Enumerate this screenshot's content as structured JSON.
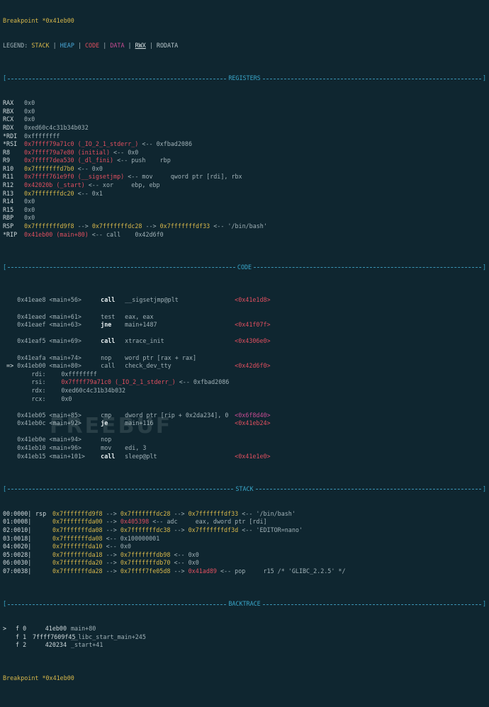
{
  "breakpoint_top": "Breakpoint *0x41eb00",
  "legend": {
    "prefix": "LEGEND: ",
    "items": [
      {
        "label": "STACK",
        "color": "#d7b74a"
      },
      {
        "label": "HEAP",
        "color": "#4aa8d8"
      },
      {
        "label": "CODE",
        "color": "#e04f5f"
      },
      {
        "label": "DATA",
        "color": "#c84c93"
      },
      {
        "label": "RWX",
        "color": "#d9e2e4"
      },
      {
        "label": "RODATA",
        "color": "#b9c7cc"
      }
    ],
    "sep": " | "
  },
  "sections": {
    "registers": "REGISTERS",
    "code": "CODE",
    "stack": "STACK",
    "backtrace": "BACKTRACE"
  },
  "registers": [
    {
      "name": "RAX",
      "parts": [
        {
          "t": "0x0",
          "c": "dim"
        }
      ]
    },
    {
      "name": "RBX",
      "parts": [
        {
          "t": "0x0",
          "c": "dim"
        }
      ]
    },
    {
      "name": "RCX",
      "parts": [
        {
          "t": "0x0",
          "c": "dim"
        }
      ]
    },
    {
      "name": "RDX",
      "parts": [
        {
          "t": "0xed60c4c31b34b032",
          "c": "dim"
        }
      ]
    },
    {
      "name": "*RDI",
      "parts": [
        {
          "t": "0xffffffff",
          "c": "dim"
        }
      ]
    },
    {
      "name": "*RSI",
      "parts": [
        {
          "t": "0x7ffff79a71c0 (_IO_2_1_stderr_)",
          "c": "red"
        },
        {
          "t": " <-- 0xfbad2086",
          "c": "dim"
        }
      ]
    },
    {
      "name": "R8",
      "parts": [
        {
          "t": "0x7ffff79a7e80 (initial)",
          "c": "red"
        },
        {
          "t": " <-- 0x0",
          "c": "dim"
        }
      ]
    },
    {
      "name": "R9",
      "parts": [
        {
          "t": "0x7ffff7dea530 (_dl_fini)",
          "c": "red"
        },
        {
          "t": " <-- push    rbp",
          "c": "dim"
        }
      ]
    },
    {
      "name": "R10",
      "parts": [
        {
          "t": "0x7fffffffd7b0",
          "c": "yellow"
        },
        {
          "t": " <-- 0x0",
          "c": "dim"
        }
      ]
    },
    {
      "name": "R11",
      "parts": [
        {
          "t": "0x7ffff761e9f0 (__sigsetjmp)",
          "c": "red"
        },
        {
          "t": " <-- mov     qword ptr [rdi], rbx",
          "c": "dim"
        }
      ]
    },
    {
      "name": "R12",
      "parts": [
        {
          "t": "0x42020b (_start)",
          "c": "red"
        },
        {
          "t": " <-- xor     ebp, ebp",
          "c": "dim"
        }
      ]
    },
    {
      "name": "R13",
      "parts": [
        {
          "t": "0x7fffffffdc20",
          "c": "yellow"
        },
        {
          "t": " <-- 0x1",
          "c": "dim"
        }
      ]
    },
    {
      "name": "R14",
      "parts": [
        {
          "t": "0x0",
          "c": "dim"
        }
      ]
    },
    {
      "name": "R15",
      "parts": [
        {
          "t": "0x0",
          "c": "dim"
        }
      ]
    },
    {
      "name": "RBP",
      "parts": [
        {
          "t": "0x0",
          "c": "dim"
        }
      ]
    },
    {
      "name": "RSP",
      "parts": [
        {
          "t": "0x7fffffffd9f8",
          "c": "yellow"
        },
        {
          "t": " --> ",
          "c": "dim"
        },
        {
          "t": "0x7fffffffdc28",
          "c": "yellow"
        },
        {
          "t": " --> ",
          "c": "dim"
        },
        {
          "t": "0x7fffffffdf33",
          "c": "yellow"
        },
        {
          "t": " <-- '/bin/bash'",
          "c": "dim"
        }
      ]
    },
    {
      "name": "*RIP",
      "parts": [
        {
          "t": "0x41eb00 (main+80)",
          "c": "red"
        },
        {
          "t": " <-- call    0x42d6f0",
          "c": "dim"
        }
      ]
    }
  ],
  "code": [
    {
      "gap": true
    },
    {
      "addr": "0x41eae8 <main+56>",
      "ins": "call",
      "bold": true,
      "op": "__sigsetjmp@plt",
      "target": "<0x41e1d8>"
    },
    {
      "gap": true
    },
    {
      "addr": "0x41eaed <main+61>",
      "ins": "test",
      "op": "eax, eax"
    },
    {
      "addr": "0x41eaef <main+63>",
      "ins": "jne",
      "bold": true,
      "op": "main+1487",
      "target": "<0x41f07f>"
    },
    {
      "gap": true
    },
    {
      "addr": "0x41eaf5 <main+69>",
      "ins": "call",
      "bold": true,
      "op": "xtrace_init",
      "target": "<0x4306e0>"
    },
    {
      "gap": true
    },
    {
      "addr": "0x41eafa <main+74>",
      "ins": "nop",
      "op": "word ptr [rax + rax]"
    },
    {
      "addr": "0x41eb00 <main+80>",
      "current": true,
      "ins": "call",
      "op": "check_dev_tty",
      "target": "<0x42d6f0>"
    },
    {
      "argname": "rdi:",
      "argparts": [
        {
          "t": "0xffffffff",
          "c": "dim"
        }
      ]
    },
    {
      "argname": "rsi:",
      "argparts": [
        {
          "t": "0x7ffff79a71c0 (_IO_2_1_stderr_)",
          "c": "red"
        },
        {
          "t": " <-- 0xfbad2086",
          "c": "dim"
        }
      ]
    },
    {
      "argname": "rdx:",
      "argparts": [
        {
          "t": "0xed60c4c31b34b032",
          "c": "dim"
        }
      ]
    },
    {
      "argname": "rcx:",
      "argparts": [
        {
          "t": "0x0",
          "c": "dim"
        }
      ]
    },
    {
      "gap": true
    },
    {
      "addr": "0x41eb05 <main+85>",
      "ins": "cmp",
      "op": "dword ptr [rip + 0x2da234], 0",
      "target": "<0x6f8d40>",
      "target_color": "magenta"
    },
    {
      "addr": "0x41eb0c <main+92>",
      "ins": "je",
      "bold": true,
      "op": "main+116",
      "target": "<0x41eb24>"
    },
    {
      "gap": true
    },
    {
      "addr": "0x41eb0e <main+94>",
      "ins": "nop",
      "op": ""
    },
    {
      "addr": "0x41eb10 <main+96>",
      "ins": "mov",
      "op": "edi, 3"
    },
    {
      "addr": "0x41eb15 <main+101>",
      "ins": "call",
      "bold": true,
      "op": "sleep@plt",
      "target": "<0x41e1e0>"
    }
  ],
  "stack": [
    {
      "idx": "00:0000|",
      "reg": "rsp",
      "parts": [
        {
          "t": "0x7fffffffd9f8",
          "c": "yellow"
        },
        {
          "t": " --> ",
          "c": "dim"
        },
        {
          "t": "0x7fffffffdc28",
          "c": "yellow"
        },
        {
          "t": " --> ",
          "c": "dim"
        },
        {
          "t": "0x7fffffffdf33",
          "c": "yellow"
        },
        {
          "t": " <-- '/bin/bash'",
          "c": "dim"
        }
      ]
    },
    {
      "idx": "01:0008|",
      "reg": "",
      "parts": [
        {
          "t": "0x7fffffffda00",
          "c": "yellow"
        },
        {
          "t": " --> ",
          "c": "dim"
        },
        {
          "t": "0x405398",
          "c": "red"
        },
        {
          "t": " <-- adc     eax, dword ptr [rdi]",
          "c": "dim"
        }
      ]
    },
    {
      "idx": "02:0010|",
      "reg": "",
      "parts": [
        {
          "t": "0x7fffffffda08",
          "c": "yellow"
        },
        {
          "t": " --> ",
          "c": "dim"
        },
        {
          "t": "0x7fffffffdc38",
          "c": "yellow"
        },
        {
          "t": " --> ",
          "c": "dim"
        },
        {
          "t": "0x7fffffffdf3d",
          "c": "yellow"
        },
        {
          "t": " <-- 'EDITOR=nano'",
          "c": "dim"
        }
      ]
    },
    {
      "idx": "03:0018|",
      "reg": "",
      "parts": [
        {
          "t": "0x7fffffffda08",
          "c": "yellow"
        },
        {
          "t": " <-- 0x100000001",
          "c": "dim"
        }
      ]
    },
    {
      "idx": "04:0020|",
      "reg": "",
      "parts": [
        {
          "t": "0x7fffffffda10",
          "c": "yellow"
        },
        {
          "t": " <-- 0x0",
          "c": "dim"
        }
      ]
    },
    {
      "idx": "05:0028|",
      "reg": "",
      "parts": [
        {
          "t": "0x7fffffffda18",
          "c": "yellow"
        },
        {
          "t": " --> ",
          "c": "dim"
        },
        {
          "t": "0x7fffffffdb98",
          "c": "yellow"
        },
        {
          "t": " <-- 0x0",
          "c": "dim"
        }
      ]
    },
    {
      "idx": "06:0030|",
      "reg": "",
      "parts": [
        {
          "t": "0x7fffffffda20",
          "c": "yellow"
        },
        {
          "t": " --> ",
          "c": "dim"
        },
        {
          "t": "0x7fffffffdb70",
          "c": "yellow"
        },
        {
          "t": " <-- 0x0",
          "c": "dim"
        }
      ]
    },
    {
      "idx": "07:0038|",
      "reg": "",
      "parts": [
        {
          "t": "0x7fffffffda28",
          "c": "yellow"
        },
        {
          "t": " --> ",
          "c": "dim"
        },
        {
          "t": "0x7ffff7fe05d8",
          "c": "yellow"
        },
        {
          "t": " --> ",
          "c": "dim"
        },
        {
          "t": "0x41ad89",
          "c": "red"
        },
        {
          "t": " <-- pop     r15 /* 'GLIBC_2.2.5' */",
          "c": "dim"
        }
      ]
    }
  ],
  "backtrace": [
    {
      "mark": ">",
      "frame": "f 0",
      "addr": "41eb00",
      "func": "main+80"
    },
    {
      "mark": "",
      "frame": "f 1",
      "addr": "7ffff7609f45",
      "func": "__libc_start_main+245"
    },
    {
      "mark": "",
      "frame": "f 2",
      "addr": "420234",
      "func": "_start+41"
    }
  ],
  "breakpoint_bottom": "Breakpoint *0x41eb00",
  "watermark": "FREEBUF"
}
